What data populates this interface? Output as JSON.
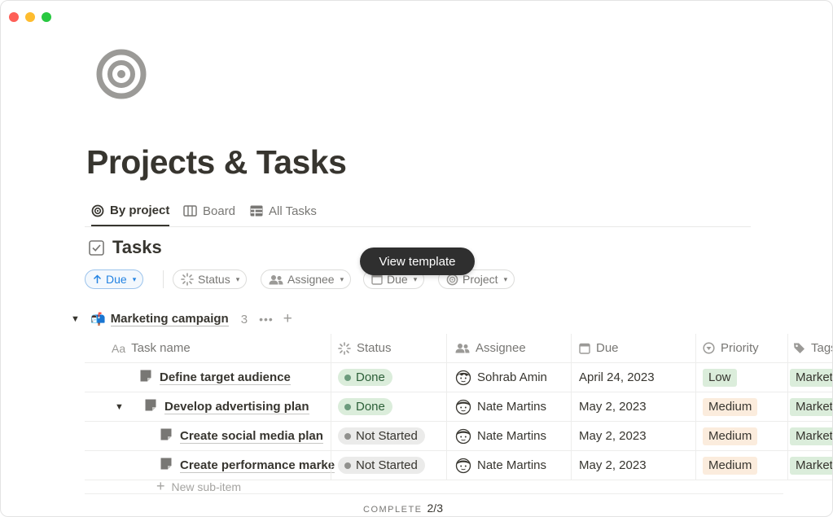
{
  "window": {
    "controls": [
      "close",
      "minimize",
      "maximize"
    ]
  },
  "page": {
    "icon": "target-icon",
    "title": "Projects & Tasks"
  },
  "views": [
    {
      "label": "By project",
      "icon": "target-icon",
      "active": true
    },
    {
      "label": "Board",
      "icon": "board-icon",
      "active": false
    },
    {
      "label": "All Tasks",
      "icon": "table-icon",
      "active": false
    }
  ],
  "database": {
    "title": "Tasks",
    "icon": "checkbox-icon"
  },
  "tooltip": {
    "label": "View template"
  },
  "filters": [
    {
      "label": "Due",
      "icon": "arrow-up-icon",
      "kind": "sort"
    },
    {
      "label": "Status",
      "icon": "status-spinner-icon",
      "kind": "filter"
    },
    {
      "label": "Assignee",
      "icon": "people-icon",
      "kind": "filter"
    },
    {
      "label": "Due",
      "icon": "calendar-icon",
      "kind": "filter"
    },
    {
      "label": "Project",
      "icon": "target-icon",
      "kind": "filter"
    }
  ],
  "group": {
    "emoji": "📬",
    "name": "Marketing campaign",
    "count": "3"
  },
  "columns": {
    "name": "Task name",
    "name_prefix": "Aa",
    "status": "Status",
    "assignee": "Assignee",
    "due": "Due",
    "priority": "Priority",
    "tags": "Tags"
  },
  "rows": [
    {
      "name": "Define target audience",
      "status": "Done",
      "assignee": "Sohrab Amin",
      "due": "April 24, 2023",
      "priority": "Low",
      "tag": "Market",
      "indent": 0,
      "expandable": false
    },
    {
      "name": "Develop advertising plan",
      "status": "Done",
      "assignee": "Nate Martins",
      "due": "May 2, 2023",
      "priority": "Medium",
      "tag": "Market",
      "indent": 0,
      "expandable": true
    },
    {
      "name": "Create social media plan",
      "status": "Not Started",
      "assignee": "Nate Martins",
      "due": "May 2, 2023",
      "priority": "Medium",
      "tag": "Market",
      "indent": 1,
      "expandable": false
    },
    {
      "name": "Create performance marke",
      "status": "Not Started",
      "assignee": "Nate Martins",
      "due": "May 2, 2023",
      "priority": "Medium",
      "tag": "Market",
      "indent": 1,
      "expandable": false
    }
  ],
  "new_sub_item": "New sub-item",
  "footer": {
    "label": "COMPLETE",
    "value": "2/3"
  },
  "colors": {
    "done": "#dbeddb",
    "not_started": "#ebebea",
    "medium": "#fbecdd",
    "sort_accent": "#2383e2"
  }
}
